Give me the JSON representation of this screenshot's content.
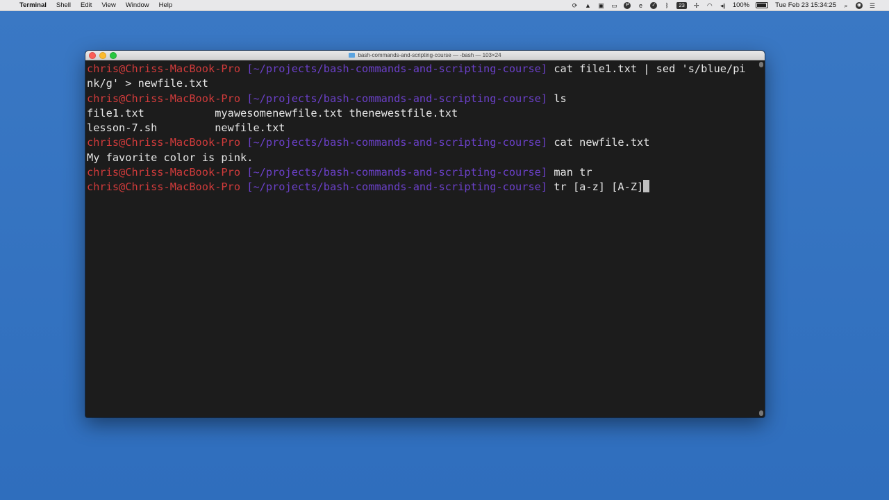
{
  "menubar": {
    "app_name": "Terminal",
    "menus": [
      "Shell",
      "Edit",
      "View",
      "Window",
      "Help"
    ],
    "status_badge": "23",
    "battery": "100%",
    "clock": "Tue Feb 23  15:34:25",
    "icons": [
      "apple-icon",
      "sync-icon",
      "upload-icon",
      "notes-icon",
      "cast-icon",
      "p-icon",
      "edge-icon",
      "check-icon",
      "bluetooth-icon",
      "wifi-icon",
      "volume-icon",
      "battery-icon",
      "search-icon",
      "user-icon",
      "menu-icon"
    ]
  },
  "window": {
    "title": "bash-commands-and-scripting-course — -bash — 103×24"
  },
  "terminal": {
    "prompt_user": "chris@Chriss-MacBook-Pro",
    "prompt_path": "[~/projects/bash-commands-and-scripting-course]",
    "lines": [
      {
        "type": "prompt",
        "command": "cat file1.txt | sed 's/blue/pi"
      },
      {
        "type": "output",
        "text": "nk/g' > newfile.txt"
      },
      {
        "type": "prompt",
        "command": "ls"
      },
      {
        "type": "output",
        "text": "file1.txt           myawesomenewfile.txt thenewestfile.txt"
      },
      {
        "type": "output",
        "text": "lesson-7.sh         newfile.txt"
      },
      {
        "type": "prompt",
        "command": "cat newfile.txt"
      },
      {
        "type": "output",
        "text": "My favorite color is pink."
      },
      {
        "type": "prompt",
        "command": "man tr"
      },
      {
        "type": "prompt",
        "command": "tr [a-z] [A-Z]",
        "cursor": true
      }
    ]
  },
  "colors": {
    "prompt_user": "#d13b3b",
    "prompt_path": "#6b40c9",
    "terminal_bg": "#1c1c1c",
    "desktop_bg": "#2f6ebd"
  }
}
